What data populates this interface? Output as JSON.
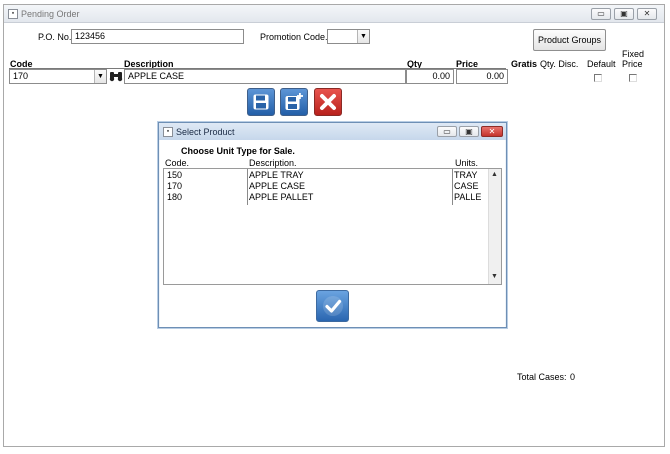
{
  "window": {
    "title": "Pending Order",
    "controls": [
      "minimize",
      "maximize",
      "close"
    ]
  },
  "header": {
    "po_label": "P.O. No.",
    "po_value": "123456",
    "promo_label": "Promotion Code.",
    "promo_value": "",
    "product_groups_label": "Product Groups"
  },
  "grid": {
    "columns": {
      "code": "Code",
      "description": "Description",
      "qty": "Qty",
      "price": "Price",
      "gratis": "Gratis",
      "qty_disc": "Qty. Disc.",
      "default": "Default",
      "fixed_price_line1": "Fixed",
      "fixed_price_line2": "Price"
    },
    "row": {
      "code": "170",
      "description": "APPLE CASE",
      "qty": "0.00",
      "price": "0.00",
      "default_checked": false,
      "fixed_price_checked": false
    }
  },
  "toolbar": {
    "save_icon": "floppy-disk-icon",
    "save_new_icon": "floppy-disk-plus-icon",
    "cancel_icon": "red-x-icon"
  },
  "dialog": {
    "title": "Select Product",
    "instruction": "Choose Unit Type for Sale.",
    "columns": {
      "code": "Code.",
      "description": "Description.",
      "units": "Units."
    },
    "items": [
      {
        "code": "150",
        "description": "APPLE TRAY",
        "units": "TRAY"
      },
      {
        "code": "170",
        "description": "APPLE CASE",
        "units": "CASE"
      },
      {
        "code": "180",
        "description": "APPLE PALLET",
        "units": "PALLE"
      }
    ],
    "ok_icon": "checkmark-icon"
  },
  "footer": {
    "total_cases_label": "Total Cases:",
    "total_cases_value": "0"
  },
  "colors": {
    "button_blue": "#2f6db8",
    "button_red": "#cc2a24",
    "dialog_border": "#6e8fb5"
  }
}
